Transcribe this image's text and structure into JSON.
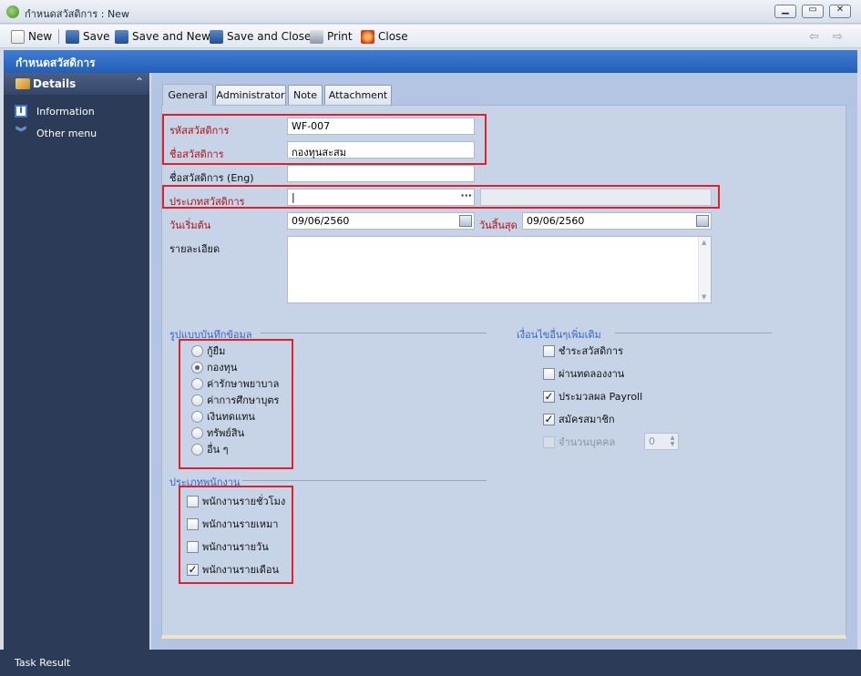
{
  "window": {
    "title": "กำหนดสวัสดิการ : New"
  },
  "toolbar": {
    "new_label": "New",
    "save_label": "Save",
    "save_new_label": "Save and New",
    "save_close_label": "Save and Close",
    "print_label": "Print",
    "close_label": "Close"
  },
  "header": {
    "title": "กำหนดสวัสดิการ"
  },
  "sidebar": {
    "section_title": "Details",
    "items": [
      {
        "label": "Information",
        "icon": "info-icon"
      },
      {
        "label": "Other menu",
        "icon": "double-chevron-down-icon"
      }
    ]
  },
  "tabs": [
    {
      "label": "General",
      "active": true
    },
    {
      "label": "Administrator",
      "active": false
    },
    {
      "label": "Note",
      "active": false
    },
    {
      "label": "Attachment",
      "active": false
    }
  ],
  "form": {
    "code": {
      "label": "รหัสสวัสดิการ",
      "value": "WF-007"
    },
    "name": {
      "label": "ชื่อสวัสดิการ",
      "value": "กองทุนสะสม"
    },
    "name_en": {
      "label": "ชื่อสวัสดิการ (Eng)",
      "value": ""
    },
    "type": {
      "label": "ประเภทสวัสดิการ",
      "value": "|",
      "button": "···",
      "description": ""
    },
    "start_date": {
      "label": "วันเริ่มต้น",
      "value": "09/06/2560"
    },
    "end_date": {
      "label": "วันสิ้นสุด",
      "value": "09/06/2560"
    },
    "detail": {
      "label": "รายละเอียด",
      "value": ""
    }
  },
  "record_format": {
    "title": "รูปแบบบันทึกข้อมูล",
    "options": [
      {
        "label": "กู้ยืม",
        "selected": false
      },
      {
        "label": "กองทุน",
        "selected": true
      },
      {
        "label": "ค่ารักษาพยาบาล",
        "selected": false
      },
      {
        "label": "ค่าการศึกษาบุตร",
        "selected": false
      },
      {
        "label": "เงินทดแทน",
        "selected": false
      },
      {
        "label": "ทรัพย์สิน",
        "selected": false
      },
      {
        "label": "อื่น ๆ",
        "selected": false
      }
    ]
  },
  "employee_type": {
    "title": "ประเภทพนักงาน",
    "options": [
      {
        "label": "พนักงานรายชั่วโมง",
        "checked": false
      },
      {
        "label": "พนักงานรายเหมา",
        "checked": false
      },
      {
        "label": "พนักงานรายวัน",
        "checked": false
      },
      {
        "label": "พนักงานรายเดือน",
        "checked": true
      }
    ]
  },
  "conditions": {
    "title": "เงื่อนไขอื่นๆเพิ่มเติม",
    "options": [
      {
        "label": "ชำระสวัสดิการ",
        "checked": false,
        "enabled": true
      },
      {
        "label": "ผ่านทดลองงาน",
        "checked": false,
        "enabled": true
      },
      {
        "label": "ประมวลผล Payroll",
        "checked": true,
        "enabled": true
      },
      {
        "label": "สมัครสมาชิก",
        "checked": true,
        "enabled": true
      },
      {
        "label": "จำนวนบุคคล",
        "checked": false,
        "enabled": false
      }
    ],
    "person_count": "0"
  },
  "checkmark": "✓",
  "radio_dot": "",
  "status": {
    "label": "Task Result"
  },
  "colors": {
    "header": "#2d69c4",
    "sidebar": "#2c3c58",
    "panel": "#c7d3e6",
    "highlight": "#e0202c"
  }
}
